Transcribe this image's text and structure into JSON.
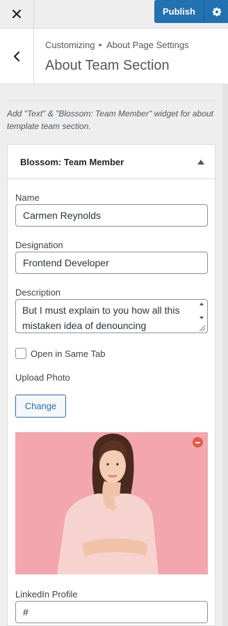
{
  "header": {
    "close_icon": "close-icon",
    "publish_label": "Publish",
    "settings_icon": "gear-icon",
    "accent": "#2271b1"
  },
  "section": {
    "back_icon": "chevron-left-icon",
    "breadcrumb_root": "Customizing",
    "breadcrumb_sep_icon": "triangle-right-icon",
    "breadcrumb_parent": "About Page Settings",
    "title": "About Team Section"
  },
  "description": "Add \"Text\" & \"Blossom: Team Member\" widget for about template team section.",
  "widget": {
    "title": "Blossom: Team Member",
    "toggle_icon": "triangle-up-icon",
    "name_label": "Name",
    "name_value": "Carmen Reynolds",
    "designation_label": "Designation",
    "designation_value": "Frontend Developer",
    "description_label": "Description",
    "description_value": "But I must explain to you how all this mistaken idea of denouncing",
    "open_same_tab_label": "Open in Same Tab",
    "open_same_tab_checked": false,
    "upload_photo_label": "Upload Photo",
    "change_label": "Change",
    "remove_icon": "remove-icon",
    "linkedin_label": "LinkedIn Profile",
    "linkedin_value": "#"
  }
}
